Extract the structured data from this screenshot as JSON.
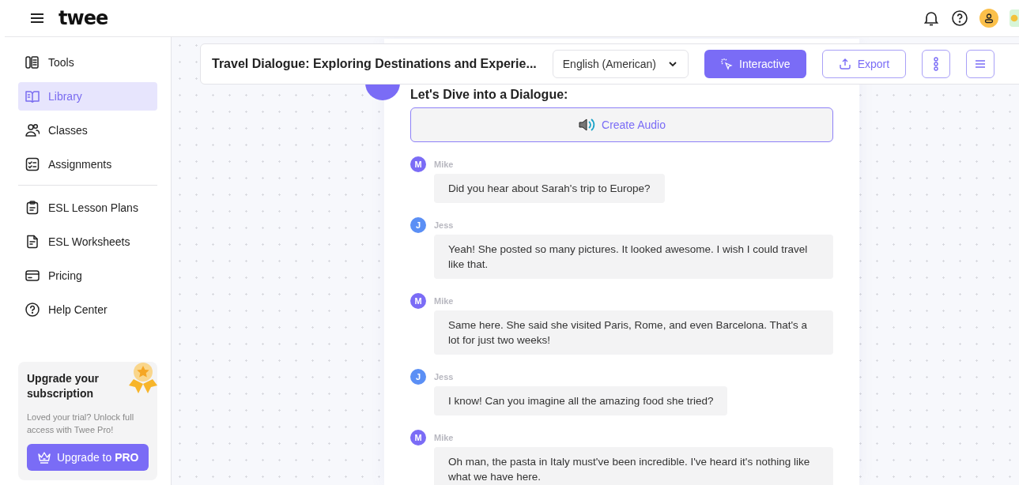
{
  "header": {
    "logo": "twee"
  },
  "sidebar": {
    "items": [
      {
        "label": "Tools",
        "selected": false
      },
      {
        "label": "Library",
        "selected": true
      },
      {
        "label": "Classes",
        "selected": false
      },
      {
        "label": "Assignments",
        "selected": false
      }
    ],
    "more_items": [
      {
        "label": "ESL Lesson Plans",
        "selected": false
      },
      {
        "label": "ESL Worksheets",
        "selected": false
      },
      {
        "label": "Pricing",
        "selected": false
      },
      {
        "label": "Help Center",
        "selected": false
      }
    ],
    "upgrade": {
      "title": "Upgrade your subscription",
      "text": "Loved your trial? Unlock full access with Twee Pro!",
      "button": "Upgrade to **PRO**"
    }
  },
  "toolbar": {
    "title": "Travel Dialogue: Exploring Destinations and Experie...",
    "language": "English (American)",
    "interactive": "Interactive",
    "export": "Export"
  },
  "content": {
    "heading": "Let's Dive into a Dialogue:",
    "audio_button": "Create Audio",
    "messages": [
      {
        "initial": "M",
        "speaker": "Mike",
        "color": "#7b6cf6",
        "text": "Did you hear about Sarah's trip to Europe?"
      },
      {
        "initial": "J",
        "speaker": "Jess",
        "color": "#5b8ff5",
        "text": "Yeah! She posted so many pictures. It looked awesome. I wish I could travel like that."
      },
      {
        "initial": "M",
        "speaker": "Mike",
        "color": "#7b6cf6",
        "text": "Same here. She said she visited Paris, Rome, and even Barcelona. That's a lot for just two weeks!"
      },
      {
        "initial": "J",
        "speaker": "Jess",
        "color": "#5b8ff5",
        "text": "I know! Can you imagine all the amazing food she tried?"
      },
      {
        "initial": "M",
        "speaker": "Mike",
        "color": "#7b6cf6",
        "text": "Oh man, the pasta in Italy must've been incredible. I've heard it's nothing like what we have here."
      }
    ]
  }
}
